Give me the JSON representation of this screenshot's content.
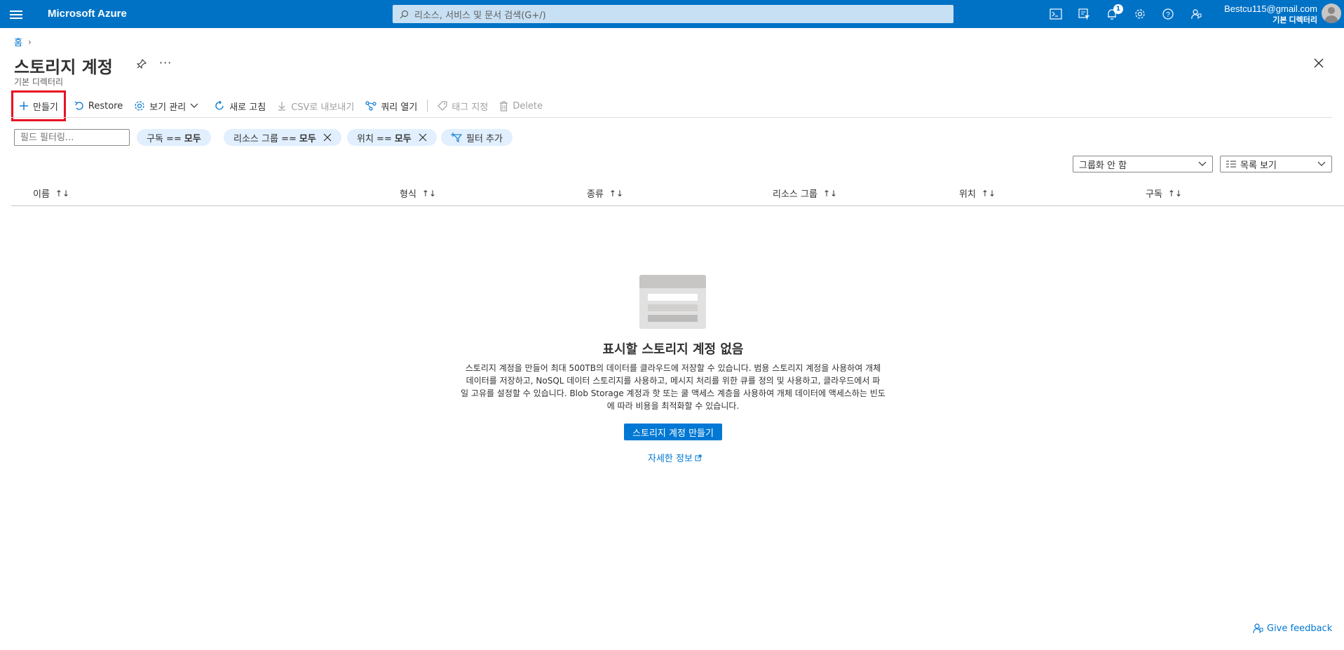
{
  "topbar": {
    "brand": "Microsoft Azure",
    "search_placeholder": "리소스, 서비스 및 문서 검색(G+/)",
    "notification_count": "1",
    "account_email": "Bestcu115@gmail.com",
    "account_directory": "기본 디렉터리",
    "icons": [
      "cloud-shell-icon",
      "directory-filter-icon",
      "bell-icon",
      "gear-icon",
      "help-icon",
      "feedback-icon"
    ]
  },
  "breadcrumb": {
    "home": "홈"
  },
  "page": {
    "title": "스토리지 계정",
    "subtitle": "기본 디렉터리"
  },
  "toolbar": {
    "create": "만들기",
    "restore": "Restore",
    "manage_view": "보기 관리",
    "refresh": "새로 고침",
    "export_csv": "CSV로 내보내기",
    "open_query": "쿼리 열기",
    "assign_tags": "태그 지정",
    "delete": "Delete"
  },
  "filters": {
    "field_placeholder": "필드 필터링...",
    "subscription": {
      "label": "구독 ==",
      "value": "모두"
    },
    "resource_group": {
      "label": "리소스 그룹 ==",
      "value": "모두"
    },
    "location": {
      "label": "위치 ==",
      "value": "모두"
    },
    "add_filter": "필터 추가"
  },
  "view": {
    "grouping": "그룹화 안 함",
    "list_view": "목록 보기"
  },
  "table": {
    "columns": [
      "이름",
      "형식",
      "종류",
      "리소스 그룹",
      "위치",
      "구독"
    ],
    "sort_symbol": "↑↓"
  },
  "empty_state": {
    "title": "표시할 스토리지 계정 없음",
    "description_lines": [
      "스토리지 계정을 만들어 최대 500TB의 데이터를 클라우드에 저장할 수 있습니다. 범용 스토리지 계정을 사용하여 개체",
      "데이터를 저장하고, NoSQL 데이터 스토리지를 사용하고, 메시지 처리를 위한 큐를 정의 및 사용하고, 클라우드에서 파",
      "일 고유를 설정할 수 있습니다. Blob Storage 계정과 핫 또는 쿨 액세스 계층을 사용하여 개체 데이터에 액세스하는 빈도",
      "에 따라 비용을 최적화할 수 있습니다."
    ],
    "create_button": "스토리지 계정 만들기",
    "learn_more": "자세한 정보"
  },
  "footer": {
    "feedback": "Give feedback"
  },
  "colors": {
    "topbar": "#0072c6",
    "accent": "#0078d4",
    "highlight_border": "#e81123",
    "pill_bg": "#e1efff"
  }
}
